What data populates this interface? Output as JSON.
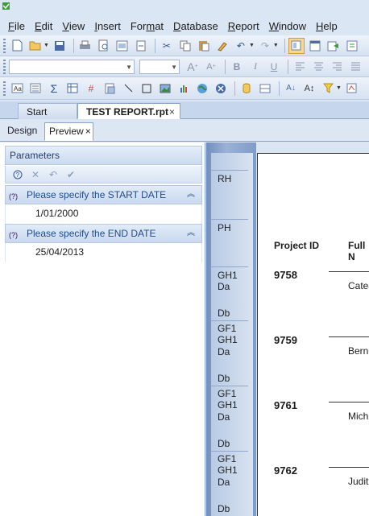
{
  "menu": [
    "File",
    "Edit",
    "View",
    "Insert",
    "Format",
    "Database",
    "Report",
    "Window",
    "Help"
  ],
  "menu_underline_index": [
    0,
    0,
    0,
    0,
    3,
    0,
    0,
    0,
    0
  ],
  "font_combo": {
    "value": ""
  },
  "size_combo": {
    "value": ""
  },
  "doc_tabs": {
    "start_page": "Start Page",
    "report": "TEST REPORT.rpt",
    "close": "×"
  },
  "view_tabs": {
    "design": "Design",
    "preview": "Preview",
    "close": "×"
  },
  "parameters": {
    "header": "Parameters",
    "items": [
      {
        "label": "Please specify the START DATE",
        "value": "1/01/2000"
      },
      {
        "label": "Please specify the END DATE",
        "value": "25/04/2013"
      }
    ]
  },
  "sections": {
    "rh": "RH",
    "ph": "PH",
    "groups": [
      {
        "header": "GH1",
        "details": [
          "Da",
          "Db"
        ],
        "footer": "GF1"
      },
      {
        "header": "GH1",
        "details": [
          "Da",
          "Db"
        ],
        "footer": "GF1"
      },
      {
        "header": "GH1",
        "details": [
          "Da",
          "Db"
        ],
        "footer": "GF1"
      },
      {
        "header": "GH1",
        "details": [
          "Da",
          "Db"
        ]
      }
    ]
  },
  "report": {
    "columns": {
      "project_id": "Project ID",
      "full_name": "Full N"
    },
    "rows": [
      {
        "id": "9758",
        "name": "Cate"
      },
      {
        "id": "9759",
        "name": "Bern"
      },
      {
        "id": "9761",
        "name": "Mich"
      },
      {
        "id": "9762",
        "name": "Judit"
      }
    ]
  },
  "icons": {
    "toolbar1": [
      "new-icon",
      "open-icon",
      "save-icon",
      "print-icon",
      "print-preview-icon",
      "export-icon",
      "refresh-icon",
      "cut-icon",
      "copy-icon",
      "paste-icon",
      "format-painter-icon",
      "undo-icon",
      "redo-icon",
      "toggle-preview-icon",
      "page-setup-icon",
      "insert-icon",
      "help-icon"
    ],
    "accent": "#f9d896"
  }
}
